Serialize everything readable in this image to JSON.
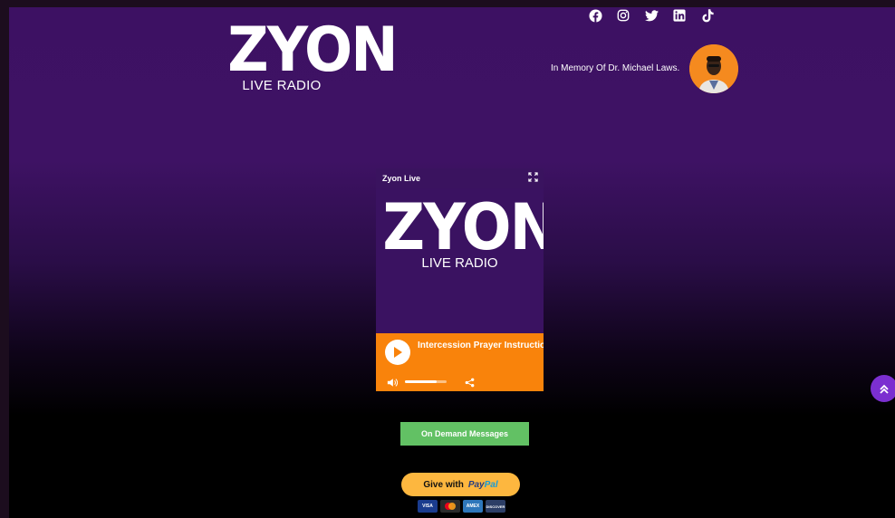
{
  "header": {
    "logo_word": "ZYON",
    "logo_subtitle": "LIVE RADIO",
    "social_icons": [
      "facebook-icon",
      "instagram-icon",
      "twitter-icon",
      "linkedin-icon",
      "tiktok-icon"
    ],
    "memorial_text": "In Memory Of Dr. Michael Laws."
  },
  "player": {
    "title": "Zyon Live",
    "logo_word": "ZYON",
    "logo_subtitle": "LIVE RADIO",
    "track": "Intercession Prayer Instruction",
    "volume_level": 0.76,
    "controls_color": "#f9830b"
  },
  "buttons": {
    "on_demand_label": "On Demand Messages",
    "give_label": "Give with",
    "paypal_label": "PayPal",
    "cards": [
      "VISA",
      "Mastercard",
      "AMEX",
      "DISCOVER"
    ]
  },
  "colors": {
    "accent_purple": "#3e1264",
    "orange": "#f9830b",
    "green": "#62c164",
    "paypal_yellow": "#fdb73f"
  }
}
